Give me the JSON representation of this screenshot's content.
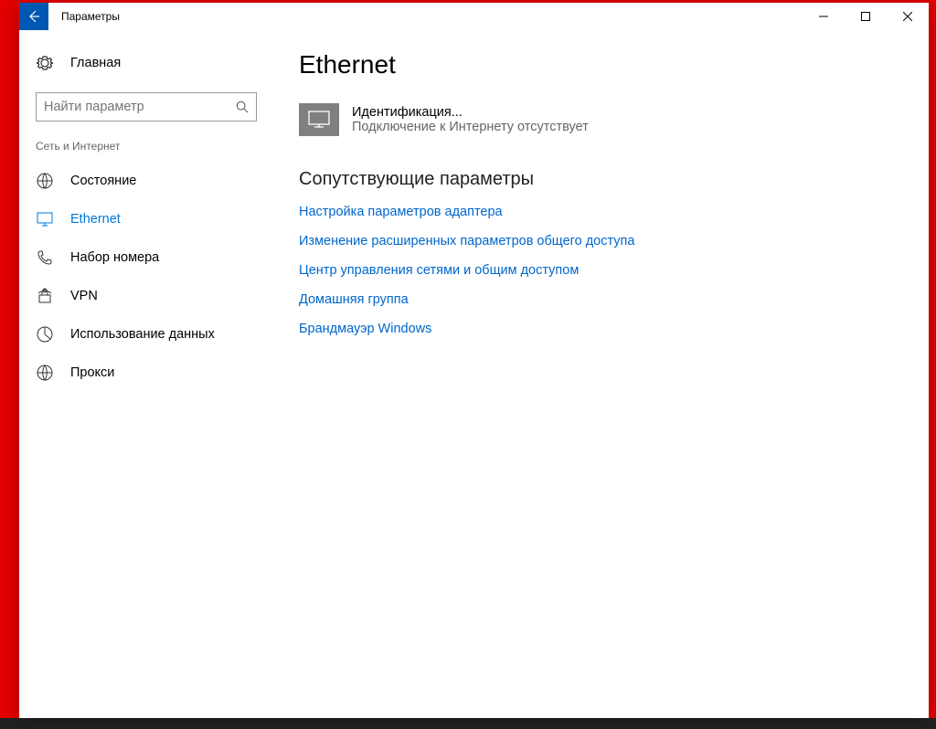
{
  "window": {
    "title": "Параметры"
  },
  "sidebar": {
    "home": "Главная",
    "search_placeholder": "Найти параметр",
    "section": "Сеть и Интернет",
    "items": [
      {
        "label": "Состояние"
      },
      {
        "label": "Ethernet"
      },
      {
        "label": "Набор номера"
      },
      {
        "label": "VPN"
      },
      {
        "label": "Использование данных"
      },
      {
        "label": "Прокси"
      }
    ]
  },
  "main": {
    "title": "Ethernet",
    "network": {
      "name": "Идентификация...",
      "status": "Подключение к Интернету отсутствует"
    },
    "related_title": "Сопутствующие параметры",
    "links": [
      "Настройка параметров адаптера",
      "Изменение расширенных параметров общего доступа",
      "Центр управления сетями и общим доступом",
      "Домашняя группа",
      "Брандмауэр Windows"
    ]
  }
}
